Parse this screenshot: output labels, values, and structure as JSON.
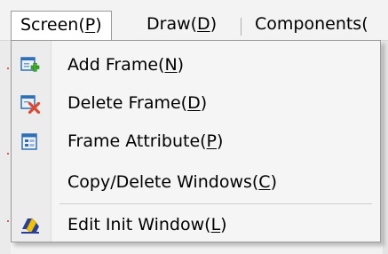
{
  "menubar": {
    "items": [
      {
        "label": "Screen(",
        "mnemonic": "P",
        "suffix": ")",
        "active": true
      },
      {
        "label": "Draw(",
        "mnemonic": "D",
        "suffix": ")",
        "active": false
      },
      {
        "label": "Components(",
        "mnemonic": "",
        "suffix": "",
        "active": false
      }
    ]
  },
  "dropdown": {
    "items": [
      {
        "label": "Add Frame(",
        "mnemonic": "N",
        "suffix": ")",
        "icon": "add-frame-icon"
      },
      {
        "label": "Delete Frame(",
        "mnemonic": "D",
        "suffix": ")",
        "icon": "delete-frame-icon"
      },
      {
        "label": "Frame Attribute(",
        "mnemonic": "P",
        "suffix": ")",
        "icon": "frame-attribute-icon"
      },
      {
        "label": "Copy/Delete Windows(",
        "mnemonic": "C",
        "suffix": ")",
        "icon": ""
      },
      {
        "label": "Edit Init Window(",
        "mnemonic": "L",
        "suffix": ")",
        "icon": "edit-init-window-icon"
      }
    ]
  },
  "colors": {
    "add_accent": "#3fae2a",
    "delete_accent": "#e0492d",
    "frame_blue": "#2f6fb6",
    "edit_yellow": "#f2c200",
    "edit_blue": "#2a3f9a"
  }
}
